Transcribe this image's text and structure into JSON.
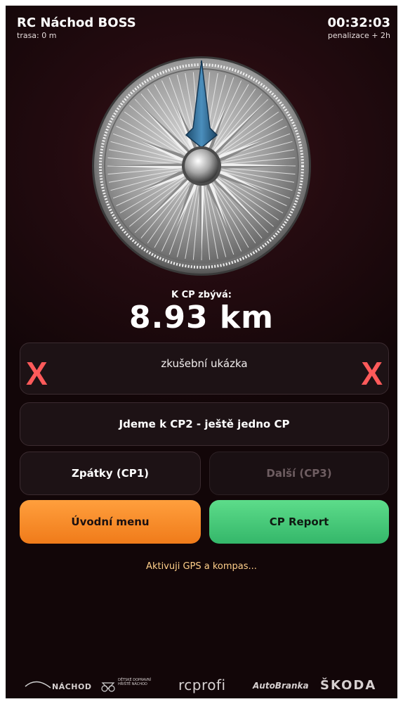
{
  "header": {
    "title": "RC Náchod BOSS",
    "route": "trasa: 0 m",
    "timer": "00:32:03",
    "penalty": "penalizace + 2h"
  },
  "distance": {
    "label": "K CP zbývá:",
    "value": "8.93 km"
  },
  "info": {
    "text": "zkušební ukázka",
    "mark": "X"
  },
  "buttons": {
    "current": "Jdeme k CP2 - ještě jedno CP",
    "back": "Zpátky (CP1)",
    "next": "Další (CP3)",
    "menu": "Úvodní menu",
    "report": "CP Report"
  },
  "status": "Aktivuji GPS a kompas...",
  "sponsors": {
    "nachod": "NÁCHOD",
    "hriste": "DĚTSKÉ DOPRAVNÍ HŘIŠTĚ NÁCHOD",
    "rcprofi": "rcprofi",
    "autobranka": "AutoBranka",
    "skoda": "ŠKODA"
  },
  "colors": {
    "accent_orange": "#f7913a",
    "accent_green": "#48c97a",
    "error_red": "#ff5a5a",
    "needle_blue": "#2f6f9a"
  },
  "icons": {
    "compass": "compass-rose-icon",
    "needle": "compass-needle-icon"
  }
}
